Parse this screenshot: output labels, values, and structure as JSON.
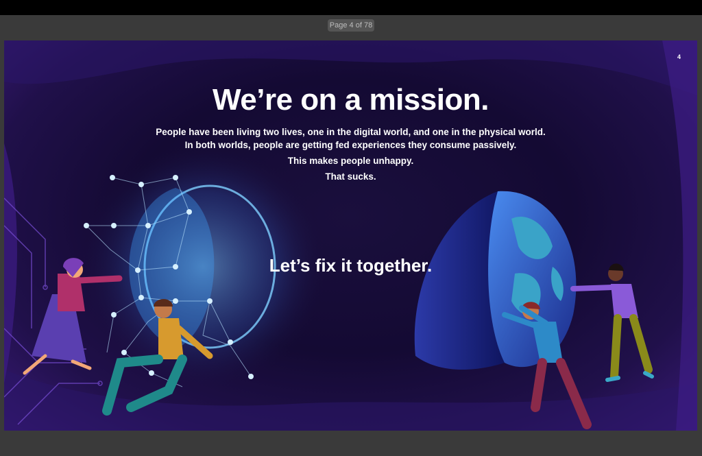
{
  "viewer": {
    "page_indicator": "Page 4 of 78"
  },
  "slide": {
    "number": "4",
    "headline": "We’re on a mission.",
    "lines": [
      "People have been living two lives, one in the digital world, and one in the physical world.",
      "In both worlds, people are getting fed experiences they consume passively.",
      "This makes people unhappy.",
      "That sucks."
    ],
    "cta": "Let’s fix it together."
  },
  "colors": {
    "background": "#140a33",
    "accent_blue": "#6fb6ff",
    "accent_purple": "#6a2fd0"
  }
}
